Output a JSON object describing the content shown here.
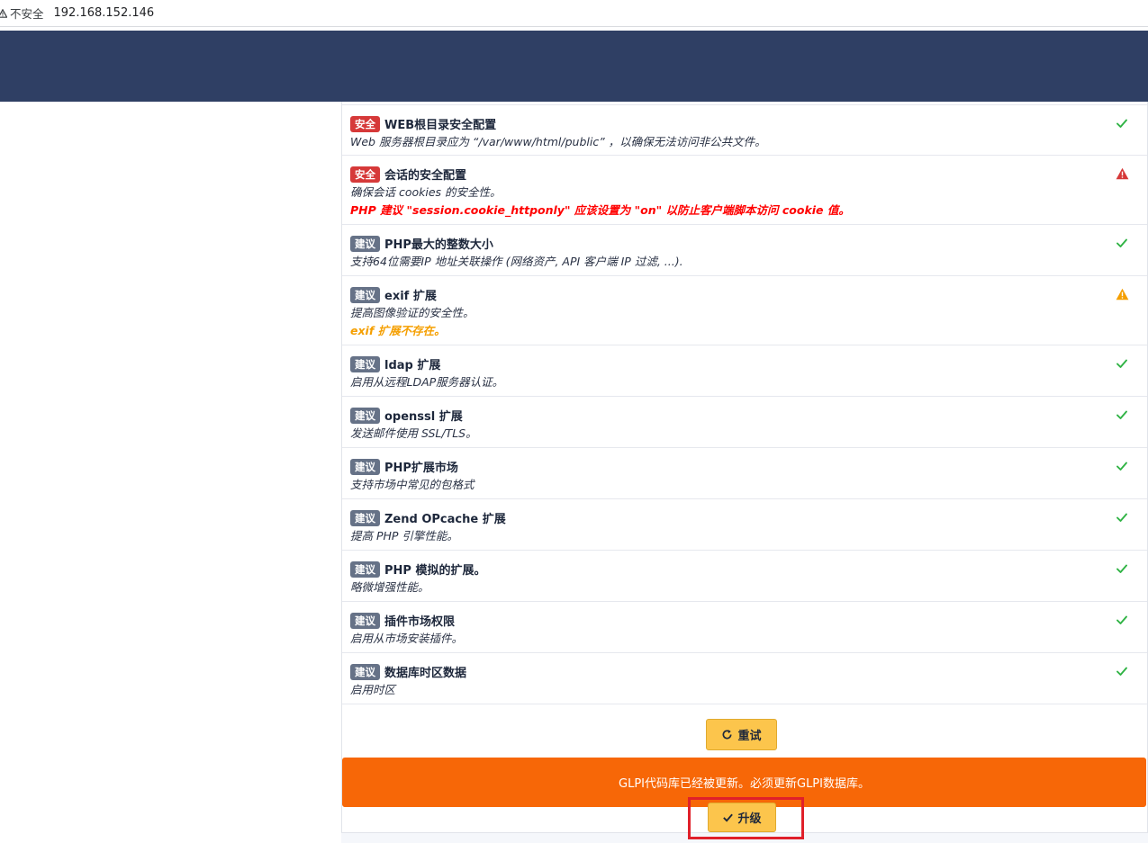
{
  "browser": {
    "security_label": "不安全",
    "url": "192.168.152.146"
  },
  "checks": [
    {
      "badge": "安全",
      "badge_type": "security",
      "title": "WEB根目录安全配置",
      "description": "Web 服务器根目录应为 “/var/www/html/public” ，以确保无法访问非公共文件。",
      "message": "",
      "status": "ok"
    },
    {
      "badge": "安全",
      "badge_type": "security",
      "title": "会话的安全配置",
      "description": "确保会话 cookies 的安全性。",
      "message": "PHP 建议 \"session.cookie_httponly\" 应该设置为 \"on\" 以防止客户端脚本访问 cookie 值。",
      "status": "error"
    },
    {
      "badge": "建议",
      "badge_type": "recommended",
      "title": "PHP最大的整数大小",
      "description": "支持64位需要IP 地址关联操作 (网络资产, API 客户端 IP 过滤, ...).",
      "message": "",
      "status": "ok"
    },
    {
      "badge": "建议",
      "badge_type": "recommended",
      "title": "exif 扩展",
      "description": "提高图像验证的安全性。",
      "message": "exif 扩展不存在。",
      "status": "warning"
    },
    {
      "badge": "建议",
      "badge_type": "recommended",
      "title": "ldap 扩展",
      "description": "启用从远程LDAP服务器认证。",
      "message": "",
      "status": "ok"
    },
    {
      "badge": "建议",
      "badge_type": "recommended",
      "title": "openssl 扩展",
      "description": "发送邮件使用 SSL/TLS。",
      "message": "",
      "status": "ok"
    },
    {
      "badge": "建议",
      "badge_type": "recommended",
      "title": "PHP扩展市场",
      "description": "支持市场中常见的包格式",
      "message": "",
      "status": "ok"
    },
    {
      "badge": "建议",
      "badge_type": "recommended",
      "title": "Zend OPcache 扩展",
      "description": "提高 PHP 引擎性能。",
      "message": "",
      "status": "ok"
    },
    {
      "badge": "建议",
      "badge_type": "recommended",
      "title": "PHP 模拟的扩展。",
      "description": "略微增强性能。",
      "message": "",
      "status": "ok"
    },
    {
      "badge": "建议",
      "badge_type": "recommended",
      "title": "插件市场权限",
      "description": "启用从市场安装插件。",
      "message": "",
      "status": "ok"
    },
    {
      "badge": "建议",
      "badge_type": "recommended",
      "title": "数据库时区数据",
      "description": "启用时区",
      "message": "",
      "status": "ok"
    }
  ],
  "actions": {
    "retry_label": "重试",
    "update_notice": "GLPI代码库已经被更新。必须更新GLPI数据库。",
    "upgrade_label": "升级"
  },
  "colors": {
    "header": "#2f3f64",
    "security_badge": "#d63939",
    "recommended_badge": "#667287",
    "ok": "#2fb344",
    "error": "#d63939",
    "warning": "#f59f00",
    "button": "#fcc54c",
    "banner": "#f76707",
    "highlight_box": "#e0202a"
  },
  "icons": {
    "ok": "check-icon",
    "error": "alert-triangle-icon",
    "warning": "alert-triangle-icon",
    "retry": "refresh-icon",
    "upgrade": "check-icon"
  }
}
